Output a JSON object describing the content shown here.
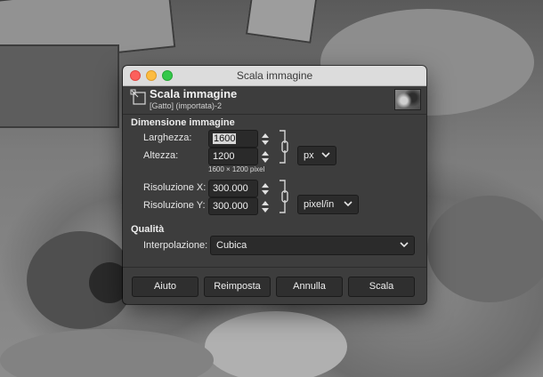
{
  "window": {
    "title": "Scala immagine"
  },
  "header": {
    "title": "Scala immagine",
    "subtitle": "[Gatto] (importata)-2"
  },
  "image_size": {
    "section_title": "Dimensione immagine",
    "width_label": "Larghezza:",
    "width_value": "1600",
    "height_label": "Altezza:",
    "height_value": "1200",
    "unit": "px",
    "pixel_info": "1600 × 1200 pixel",
    "res_x_label": "Risoluzione X:",
    "res_x_value": "300.000",
    "res_y_label": "Risoluzione Y:",
    "res_y_value": "300.000",
    "res_unit": "pixel/in"
  },
  "quality": {
    "section_title": "Qualità",
    "interp_label": "Interpolazione:",
    "interp_value": "Cubica"
  },
  "buttons": {
    "help": "Aiuto",
    "reset": "Reimposta",
    "cancel": "Annulla",
    "scale": "Scala"
  },
  "colors": {
    "dialog_bg": "#3d3d3d",
    "titlebar_bg": "#dcdcdc",
    "close": "#fc605c",
    "minimize": "#fdbc40",
    "maximize": "#34c84a"
  }
}
